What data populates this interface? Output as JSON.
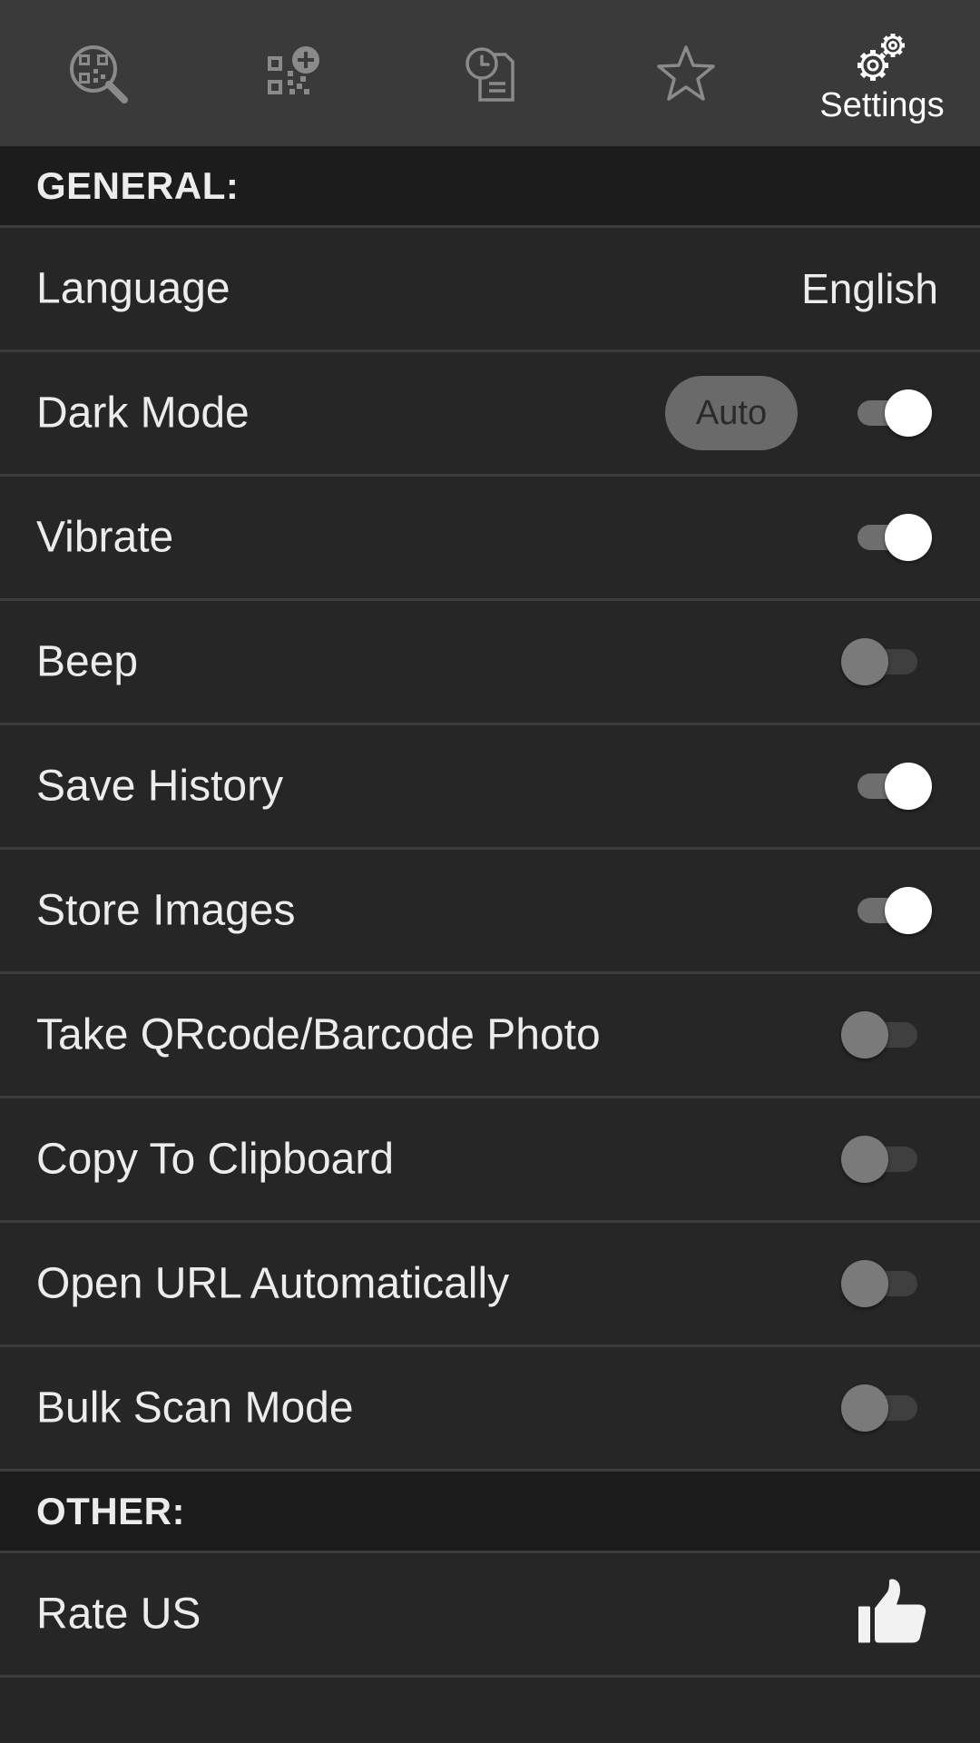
{
  "tabs": [
    {
      "icon": "qr-scan-icon",
      "label": ""
    },
    {
      "icon": "qr-create-icon",
      "label": ""
    },
    {
      "icon": "history-icon",
      "label": ""
    },
    {
      "icon": "star-icon",
      "label": ""
    },
    {
      "icon": "gear-icon",
      "label": "Settings",
      "active": true
    }
  ],
  "sections": {
    "general": "GENERAL:",
    "other": "OTHER:"
  },
  "rows": {
    "language": {
      "label": "Language",
      "value": "English"
    },
    "dark_mode": {
      "label": "Dark Mode",
      "pill": "Auto",
      "on": true
    },
    "vibrate": {
      "label": "Vibrate",
      "on": true
    },
    "beep": {
      "label": "Beep",
      "on": false
    },
    "save_history": {
      "label": "Save History",
      "on": true
    },
    "store_images": {
      "label": "Store Images",
      "on": true
    },
    "take_photo": {
      "label": "Take QRcode/Barcode Photo",
      "on": false
    },
    "copy_clipboard": {
      "label": "Copy To Clipboard",
      "on": false
    },
    "open_url": {
      "label": "Open URL Automatically",
      "on": false
    },
    "bulk_scan": {
      "label": "Bulk Scan Mode",
      "on": false
    },
    "rate_us": {
      "label": "Rate US",
      "icon": "thumbs-up-icon"
    }
  },
  "colors": {
    "background": "#262626",
    "tabbar": "#3a3a3a",
    "section_header": "#1c1c1c",
    "divider": "#3c3c3c",
    "toggle_on_thumb": "#ffffff",
    "toggle_off_thumb": "#7a7a7a"
  }
}
